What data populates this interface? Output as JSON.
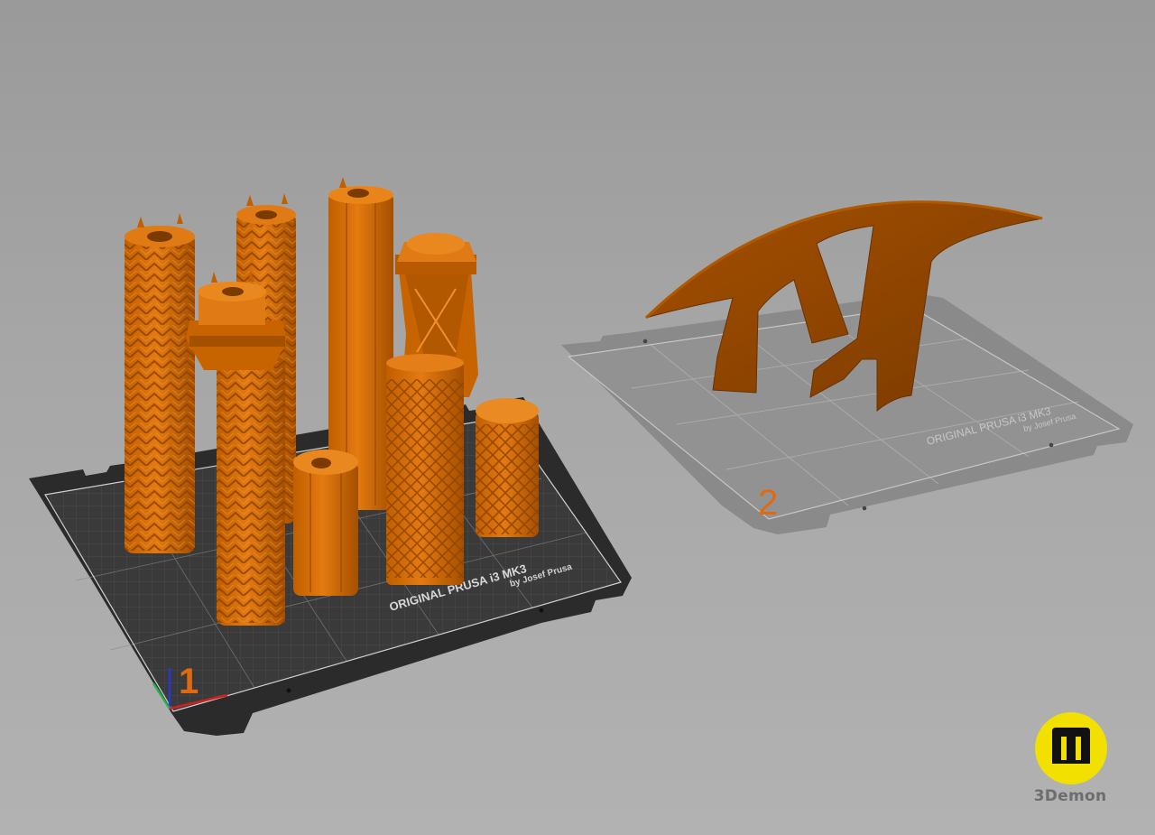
{
  "viewport": {
    "background_color": "#a3a3a3",
    "model_color": "#d96f00",
    "model_color_dark": "#8a4a00"
  },
  "plates": [
    {
      "number": "1",
      "printer_label": "ORIGINAL PRUSA i3 MK3",
      "printer_sublabel": "by Josef Prusa",
      "style": "textured-dark",
      "plate_color": "#2b2b2b",
      "number_color": "#e06a10",
      "axes_icon": "xyz-axes-icon"
    },
    {
      "number": "2",
      "printer_label": "ORIGINAL PRUSA i3 MK3",
      "printer_sublabel": "by Josef Prusa",
      "style": "smooth-gray",
      "plate_color": "#8e8e8e",
      "number_color": "#e06a10"
    }
  ],
  "objects": {
    "plate_1": [
      "braided-column",
      "braided-column",
      "braided-column-with-capital",
      "tall-plain-column",
      "tower-column-with-capital",
      "short-hollow-column",
      "short-lattice-column"
    ],
    "plate_2": [
      "arch-bridge-support"
    ]
  },
  "brand": {
    "name": "3Demon",
    "icon": "3demon-logo-icon",
    "logo_color": "#f2e000"
  }
}
